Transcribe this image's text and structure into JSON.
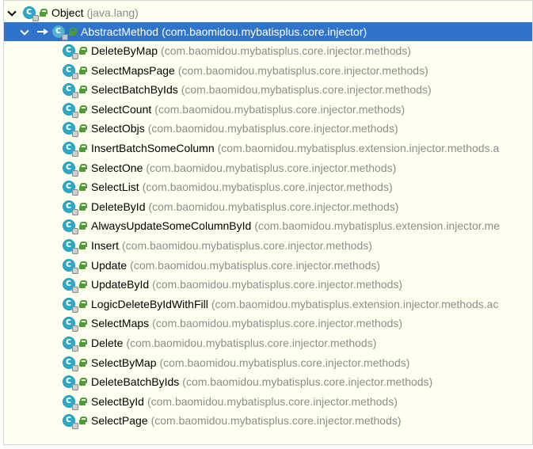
{
  "tree": {
    "root": {
      "label": "Object",
      "package": "(java.lang)"
    },
    "selected": {
      "label": "AbstractMethod",
      "package": "(com.baomidou.mybatisplus.core.injector)"
    },
    "children": [
      {
        "label": "DeleteByMap",
        "package": "(com.baomidou.mybatisplus.core.injector.methods)"
      },
      {
        "label": "SelectMapsPage",
        "package": "(com.baomidou.mybatisplus.core.injector.methods)"
      },
      {
        "label": "SelectBatchByIds",
        "package": "(com.baomidou.mybatisplus.core.injector.methods)"
      },
      {
        "label": "SelectCount",
        "package": "(com.baomidou.mybatisplus.core.injector.methods)"
      },
      {
        "label": "SelectObjs",
        "package": "(com.baomidou.mybatisplus.core.injector.methods)"
      },
      {
        "label": "InsertBatchSomeColumn",
        "package": "(com.baomidou.mybatisplus.extension.injector.methods.a"
      },
      {
        "label": "SelectOne",
        "package": "(com.baomidou.mybatisplus.core.injector.methods)"
      },
      {
        "label": "SelectList",
        "package": "(com.baomidou.mybatisplus.core.injector.methods)"
      },
      {
        "label": "DeleteById",
        "package": "(com.baomidou.mybatisplus.core.injector.methods)"
      },
      {
        "label": "AlwaysUpdateSomeColumnById",
        "package": "(com.baomidou.mybatisplus.extension.injector.me"
      },
      {
        "label": "Insert",
        "package": "(com.baomidou.mybatisplus.core.injector.methods)"
      },
      {
        "label": "Update",
        "package": "(com.baomidou.mybatisplus.core.injector.methods)"
      },
      {
        "label": "UpdateById",
        "package": "(com.baomidou.mybatisplus.core.injector.methods)"
      },
      {
        "label": "LogicDeleteByIdWithFill",
        "package": "(com.baomidou.mybatisplus.extension.injector.methods.ac"
      },
      {
        "label": "SelectMaps",
        "package": "(com.baomidou.mybatisplus.core.injector.methods)"
      },
      {
        "label": "Delete",
        "package": "(com.baomidou.mybatisplus.core.injector.methods)"
      },
      {
        "label": "SelectByMap",
        "package": "(com.baomidou.mybatisplus.core.injector.methods)"
      },
      {
        "label": "DeleteBatchByIds",
        "package": "(com.baomidou.mybatisplus.core.injector.methods)"
      },
      {
        "label": "SelectById",
        "package": "(com.baomidou.mybatisplus.core.injector.methods)"
      },
      {
        "label": "SelectPage",
        "package": "(com.baomidou.mybatisplus.core.injector.methods)"
      }
    ]
  }
}
